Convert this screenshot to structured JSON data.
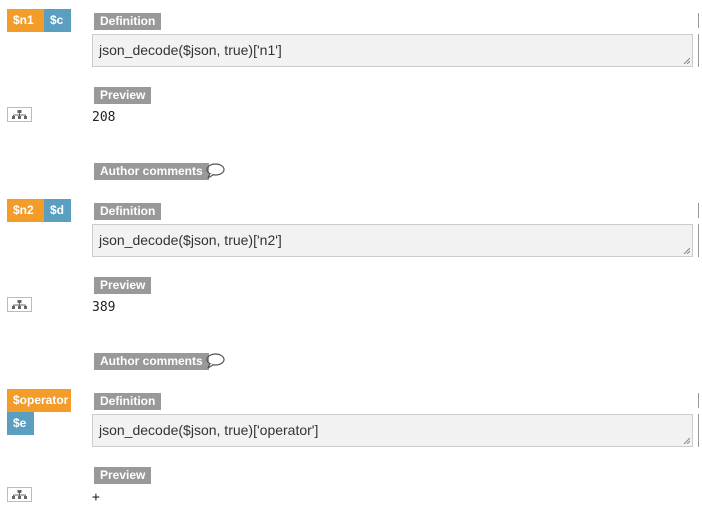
{
  "labels": {
    "definition": "Definition",
    "preview": "Preview",
    "author_comments": "Author comments"
  },
  "variables": [
    {
      "name": "$n1",
      "alias": "$c",
      "definition": "json_decode($json, true)['n1']",
      "preview": "208"
    },
    {
      "name": "$n2",
      "alias": "$d",
      "definition": "json_decode($json, true)['n2']",
      "preview": "389"
    },
    {
      "name": "$operator",
      "alias": "$e",
      "definition": "json_decode($json, true)['operator']",
      "preview": "+"
    }
  ],
  "icons": {
    "tree": "sitemap-icon",
    "comment": "speech-bubble-icon",
    "resize": "resize-grip-icon"
  },
  "colors": {
    "primary_tag": "#f39c2a",
    "alias_tag": "#5b9fc0",
    "label_bg": "#999999",
    "definition_bg": "#f2f2f2"
  }
}
